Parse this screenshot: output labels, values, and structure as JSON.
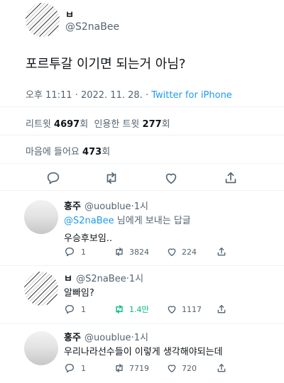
{
  "main_tweet": {
    "author_name": "ㅂ",
    "author_handle": "@S2naBee",
    "text": "포르투갈 이기면 되는거 아님?",
    "time": "오후 11:11",
    "sep1": "·",
    "date": "2022. 11. 28.",
    "sep2": "·",
    "source": "Twitter for iPhone",
    "retweets_label": "리트윗",
    "retweets_count": "4697",
    "retweets_suffix": "회",
    "quotes_label": "인용한 트윗",
    "quotes_count": "277",
    "quotes_suffix": "회",
    "likes_label": "마음에 들어요",
    "likes_count": "473",
    "likes_suffix": "회"
  },
  "replies": [
    {
      "author_name": "홍주",
      "author_handle": "@uoublue",
      "dot": "·",
      "time": "1시",
      "reply_to_mention": "@S2naBee",
      "reply_to_suffix": "님에게 보내는 답글",
      "text": "우승후보임..",
      "reply_count": "1",
      "retweet_count": "3824",
      "like_count": "224"
    },
    {
      "author_name": "ㅂ",
      "author_handle": "@S2naBee",
      "dot": "·",
      "time": "1시",
      "text": "알빠임?",
      "reply_count": "1",
      "retweet_count": "1.4만",
      "like_count": "1117"
    },
    {
      "author_name": "홍주",
      "author_handle": "@uoublue",
      "dot": "·",
      "time": "1시",
      "text": "우리나라선수들이 이렇게 생각해야되는데",
      "reply_count": "1",
      "retweet_count": "7719",
      "like_count": "720"
    }
  ],
  "colors": {
    "text_primary": "#0f1419",
    "text_secondary": "#536471",
    "link_blue": "#1d9bf0",
    "retweet_green": "#00ba7c",
    "divider": "#eff3f4"
  },
  "icons": [
    "reply-icon",
    "retweet-icon",
    "like-icon",
    "share-icon"
  ]
}
